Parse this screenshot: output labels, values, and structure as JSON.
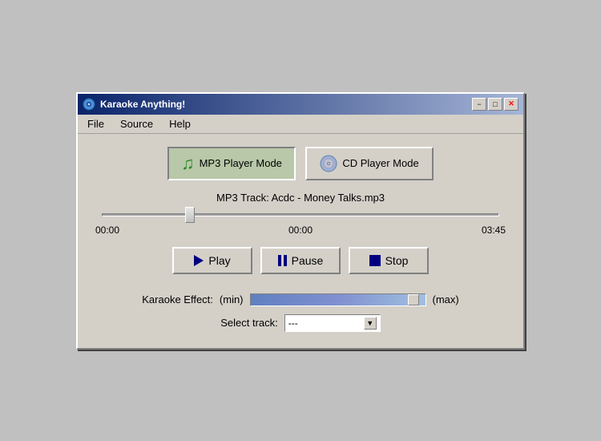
{
  "window": {
    "title": "Karaoke Anything!",
    "minimize_label": "−",
    "maximize_label": "□",
    "close_label": "✕"
  },
  "menubar": {
    "items": [
      {
        "label": "File"
      },
      {
        "label": "Source"
      },
      {
        "label": "Help"
      }
    ]
  },
  "modes": {
    "mp3_label": "MP3 Player Mode",
    "cd_label": "CD Player Mode"
  },
  "track": {
    "info": "MP3 Track: Acdc  -  Money Talks.mp3"
  },
  "times": {
    "elapsed": "00:00",
    "current": "00:00",
    "total": "03:45"
  },
  "transport": {
    "play_label": "Play",
    "pause_label": "Pause",
    "stop_label": "Stop"
  },
  "karaoke": {
    "label": "Karaoke Effect:",
    "min_label": "(min)",
    "max_label": "(max)"
  },
  "select_track": {
    "label": "Select track:",
    "value": "---"
  }
}
